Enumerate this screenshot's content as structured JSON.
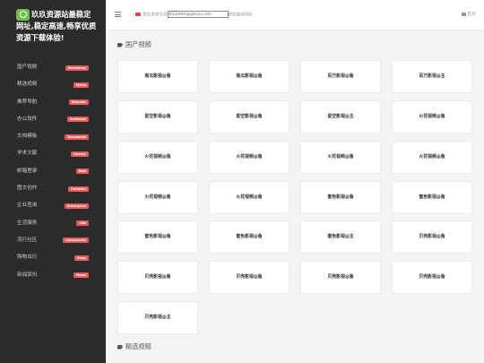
{
  "brand": {
    "title_lines": [
      "玖玖资源站最稳定",
      "网址,稳定高速,畅享优质",
      "资源下载体验!"
    ]
  },
  "header": {
    "mail_label": "发任意邮件到",
    "mail_value": "k0209m@gmail.com",
    "mail_suffix": "获取最新网址",
    "home_label": "首页"
  },
  "nav": [
    {
      "label": "国产视频",
      "badge": "Bootstrap"
    },
    {
      "label": "精选视频",
      "badge": "Video"
    },
    {
      "label": "推荐导航",
      "badge": "Website"
    },
    {
      "label": "办公软件",
      "badge": "Software"
    },
    {
      "label": "文档模板",
      "badge": "Document"
    },
    {
      "label": "学术文献",
      "badge": "Library"
    },
    {
      "label": "邮箱登录",
      "badge": "Mail"
    },
    {
      "label": "图文创作",
      "badge": "Creation"
    },
    {
      "label": "企业查询",
      "badge": "Enterprise"
    },
    {
      "label": "生活服务",
      "badge": "Life"
    },
    {
      "label": "流行社区",
      "badge": "Community"
    },
    {
      "label": "购物出行",
      "badge": "Shop"
    },
    {
      "label": "新闻资讯",
      "badge": "News"
    }
  ],
  "sections": [
    {
      "title": "国产视频",
      "cards": [
        "南瓜影视@备",
        "南瓜影视@备",
        "百万影视@备",
        "百万影视@主",
        "星空影视@备",
        "星空影视@备",
        "星空影视@主",
        "火花视频@备",
        "火花视频@备",
        "火花视频@备",
        "火花视频@备",
        "火花视频@备",
        "火花视频@备",
        "火花视频@备",
        "蜜色影视@备",
        "蜜色影视@备",
        "蜜色影视@备",
        "蜜色影视@备",
        "蜜色影视@主",
        "贝壳影视@备",
        "贝壳影视@备",
        "贝壳影视@备",
        "贝壳影视@备",
        "贝壳影视@备",
        "贝壳影视@主"
      ]
    },
    {
      "title": "精选视频",
      "cards": []
    }
  ],
  "icons": [
    "menu-icon",
    "mail-icon",
    "home-icon",
    "tag-icon",
    "logo-icon"
  ],
  "colors": {
    "sidebar": "#2b2b2b",
    "badge": "#e85a5a",
    "logo": "#6cc04a",
    "mail": "#e04848"
  }
}
